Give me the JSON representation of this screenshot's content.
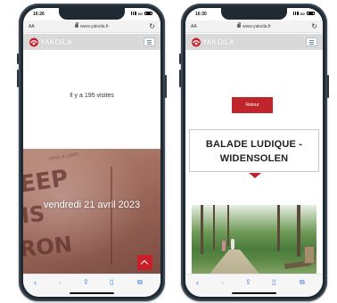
{
  "left_phone": {
    "status": {
      "time": "16:26",
      "network": "5G"
    },
    "browser": {
      "text_size": "AA",
      "url": "www.yakoila.fr"
    },
    "header": {
      "logo_text": "YAKOILA"
    },
    "content": {
      "visits_text": "Il y a 195 visites",
      "date_overlay": "vendredi 21 avril 2023",
      "ticket_words": {
        "word_1": "EEP",
        "word_2": "IS",
        "word_3": "RON",
        "small_1": "OYAG & LABEL"
      }
    }
  },
  "right_phone": {
    "status": {
      "time": "16:30",
      "network": "5G"
    },
    "browser": {
      "text_size": "AA",
      "url": "www.yakoila.fr"
    },
    "header": {
      "logo_text": "YAKOILA"
    },
    "content": {
      "back_button": "Retour",
      "title_line_1": "BALADE LUDIQUE -",
      "title_line_2": "WIDENSOLEN"
    }
  },
  "colors": {
    "brand_red": "#c0252b",
    "header_grey": "#d9d9d9",
    "ios_blue": "#3b7ddd"
  },
  "icons": [
    "lock-icon",
    "reload-icon",
    "menu-icon",
    "back-icon",
    "forward-icon",
    "share-icon",
    "bookmarks-icon",
    "tabs-icon",
    "scroll-top-icon"
  ]
}
